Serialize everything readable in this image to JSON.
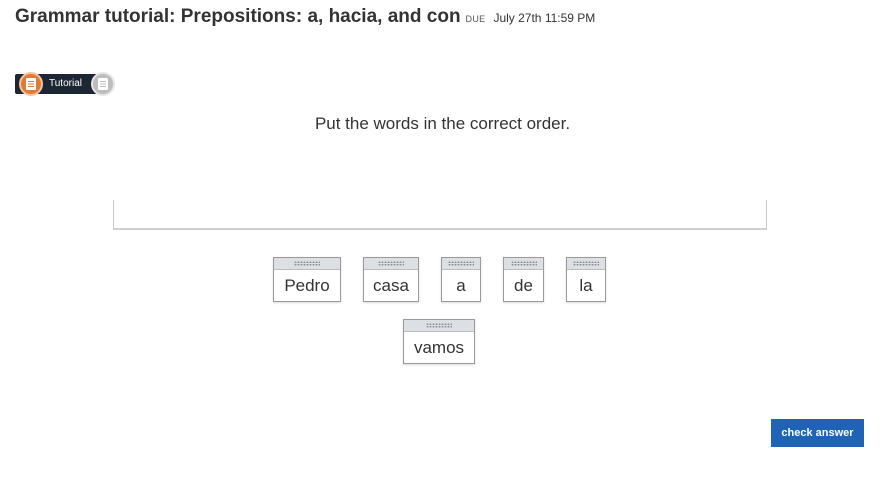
{
  "header": {
    "title": "Grammar tutorial: Prepositions: a, hacia, and con",
    "due_label": "DUE",
    "due_date": "July 27th 11:59 PM"
  },
  "progress": {
    "current_step_label": "Tutorial",
    "step_icons": [
      "document-icon",
      "document-icon"
    ],
    "colors": {
      "active": "#e07b39",
      "inactive": "#bdbdbd",
      "track": "#1d2733"
    }
  },
  "exercise": {
    "instruction": "Put the words in the correct order.",
    "word_tiles": [
      "Pedro",
      "casa",
      "a",
      "de",
      "la",
      "vamos"
    ]
  },
  "actions": {
    "check_answer_label": "check answer",
    "accent_color": "#1e63b6"
  }
}
